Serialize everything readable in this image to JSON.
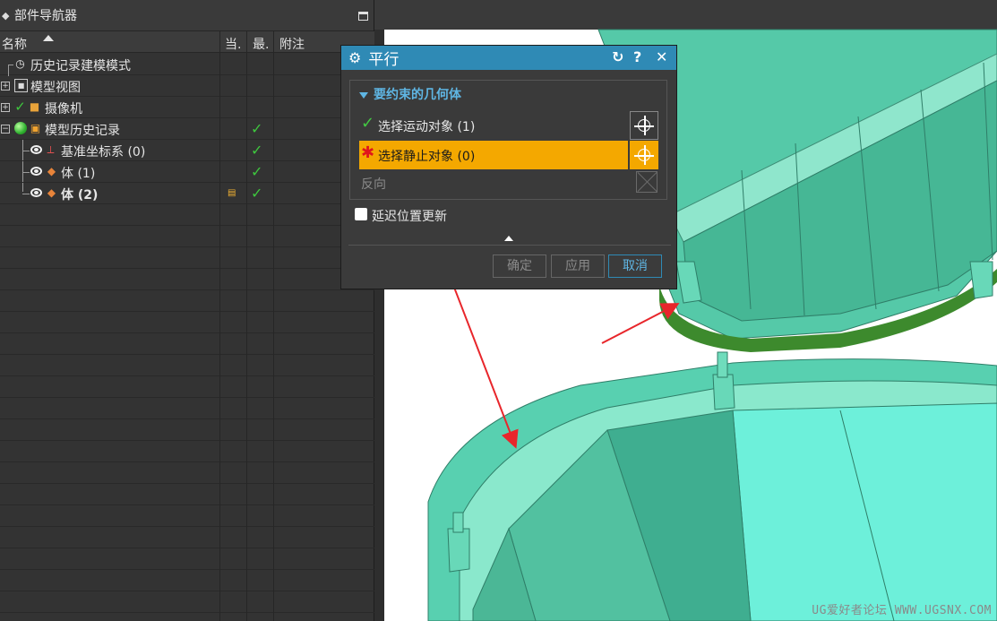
{
  "navigator": {
    "title": "部件导航器",
    "columns": {
      "name": "名称",
      "current": "当.",
      "latest": "最.",
      "note": "附注"
    },
    "rows": [
      {
        "label": "历史记录建模模式"
      },
      {
        "label": "模型视图"
      },
      {
        "label": "摄像机"
      },
      {
        "label": "模型历史记录"
      },
      {
        "label": "基准坐标系 (0)"
      },
      {
        "label": "体 (1)"
      },
      {
        "label": "体 (2)"
      }
    ]
  },
  "dialog": {
    "title": "平行",
    "group_title": "要约束的几何体",
    "select_moving": "选择运动对象 (1)",
    "select_stationary": "选择静止对象 (0)",
    "reverse": "反向",
    "defer_update": "延迟位置更新",
    "buttons": {
      "ok": "确定",
      "apply": "应用",
      "cancel": "取消"
    }
  },
  "watermark": "UG爱好者论坛 WWW.UGSNX.COM",
  "colors": {
    "accent": "#2f8ab5",
    "highlight": "#f4a800",
    "check": "#3ec73e",
    "model": "#5fd8bc",
    "arrow": "#e8262b"
  }
}
